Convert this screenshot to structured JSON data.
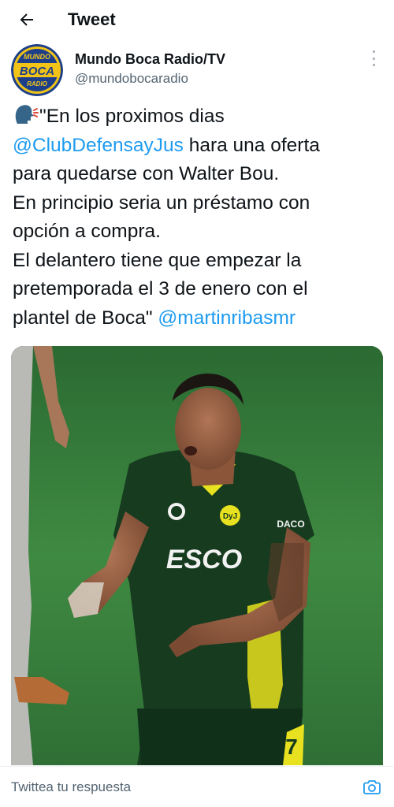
{
  "header": {
    "title": "Tweet"
  },
  "author": {
    "display_name": "Mundo Boca Radio/TV",
    "handle": "@mundobocaradio",
    "avatar_text": [
      "MUNDO",
      "BOCA",
      "RADIO"
    ]
  },
  "tweet": {
    "lines": [
      {
        "parts": [
          {
            "type": "icon",
            "name": "speaking-head-icon"
          },
          {
            "type": "text",
            "text": "\"En los proximos dias"
          }
        ]
      },
      {
        "parts": [
          {
            "type": "mention",
            "text": "@ClubDefensayJus"
          },
          {
            "type": "text",
            "text": " hara una oferta"
          }
        ]
      },
      {
        "parts": [
          {
            "type": "text",
            "text": "para quedarse con Walter Bou."
          }
        ]
      },
      {
        "parts": [
          {
            "type": "text",
            "text": "En principio seria un préstamo con"
          }
        ]
      },
      {
        "parts": [
          {
            "type": "text",
            "text": "opción a compra."
          }
        ]
      },
      {
        "parts": [
          {
            "type": "text",
            "text": "El delantero tiene que empezar la"
          }
        ]
      },
      {
        "parts": [
          {
            "type": "text",
            "text": "pretemporada el 3 de enero con el"
          }
        ]
      },
      {
        "parts": [
          {
            "type": "text",
            "text": "plantel de Boca\" "
          },
          {
            "type": "mention",
            "text": "@martinribasmr"
          }
        ]
      }
    ]
  },
  "media": {
    "shirt_sponsor": "ESCO",
    "shirt_brand": "DACO",
    "badge_text": "DyJ",
    "kit_number": "7"
  },
  "reply": {
    "placeholder": "Twittea tu respuesta"
  },
  "colors": {
    "link": "#1d9bf0",
    "secondary_text": "#536471",
    "kit_green": "#163b1f",
    "kit_yellow": "#e8e11f"
  }
}
